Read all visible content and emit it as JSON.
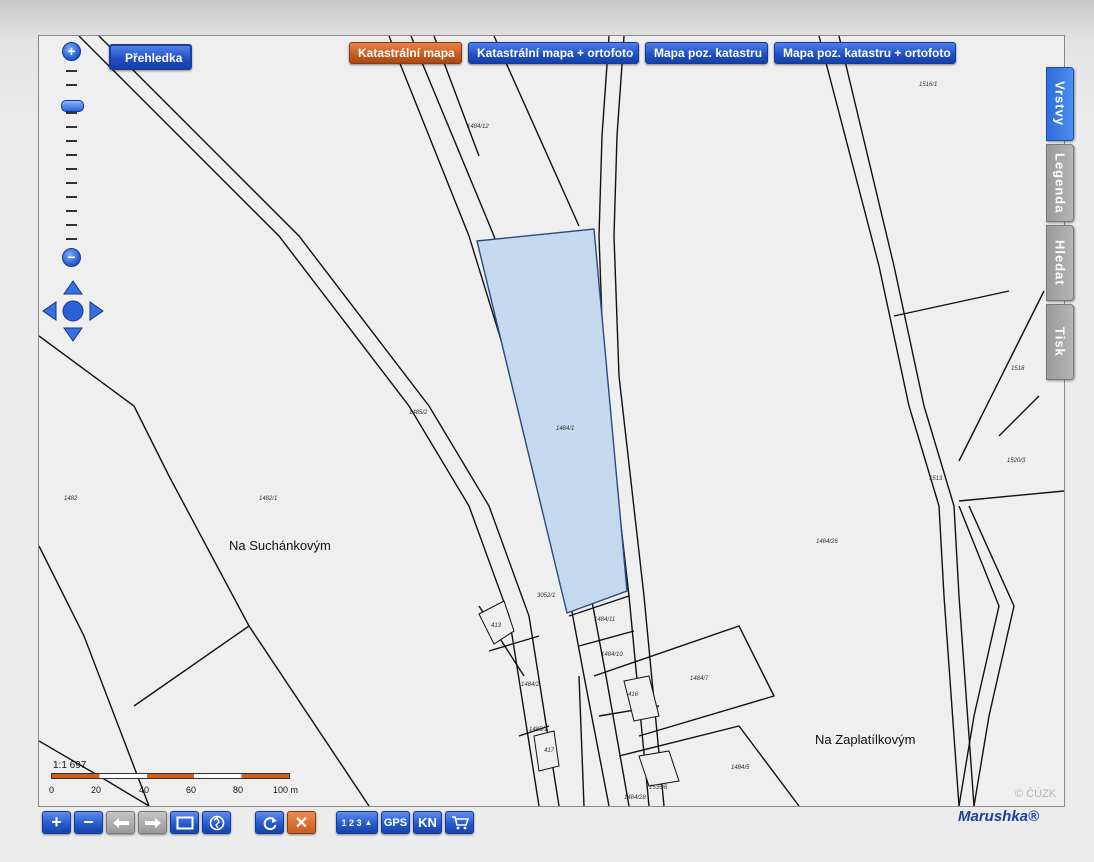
{
  "overview_button": "Přehledka",
  "map_types": [
    {
      "label": "Katastrální mapa",
      "active": true
    },
    {
      "label": "Katastrální mapa + ortofoto",
      "active": false
    },
    {
      "label": "Mapa poz. katastru",
      "active": false
    },
    {
      "label": "Mapa poz. katastru + ortofoto",
      "active": false
    }
  ],
  "side_tabs": [
    {
      "label": "Vrstvy",
      "active": true
    },
    {
      "label": "Legenda",
      "active": false
    },
    {
      "label": "Hledat",
      "active": false
    },
    {
      "label": "Tisk",
      "active": false
    }
  ],
  "place_names": {
    "west": "Na Suchánkovým",
    "east": "Na Zaplatílkovým"
  },
  "parcel_numbers": {
    "p1": "1484/12",
    "p2": "1516/1",
    "p3": "1485/2",
    "p4": "1484/1",
    "p5": "1482",
    "p6": "1482/1",
    "p7": "1484/26",
    "p8": "3052/1",
    "p9": "1484/11",
    "p10": "1484/10",
    "p11": "413",
    "p12": "1484/2",
    "p13": "1484/7",
    "p14": "416",
    "p15": "1485/1",
    "p16": "1484/5",
    "p17": "1535/6",
    "p18": "1484/28",
    "p19": "1513",
    "p20": "1518",
    "p21": "1520/3",
    "p22": "417"
  },
  "scale": {
    "ratio": "1:1 697",
    "ticks": [
      "0",
      "20",
      "40",
      "60",
      "80",
      "100 m"
    ]
  },
  "copyright": "© ČÚZK",
  "brand": "Marushka®",
  "toolbar": {
    "gps": "GPS",
    "kn": "KN",
    "measure_digits": "1 2 3"
  },
  "colors": {
    "selected_parcel": "#c5d9ee",
    "accent_blue": "#2456cc",
    "active_orange": "#c85a1f"
  }
}
